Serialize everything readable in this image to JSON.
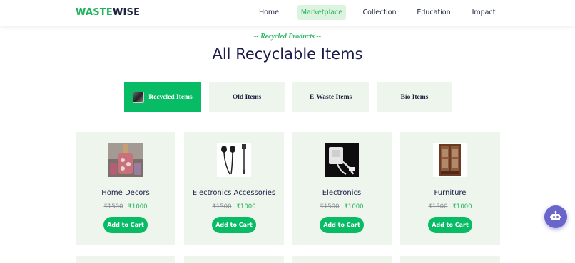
{
  "header": {
    "logo_part1": "WASTE",
    "logo_part2": "WISE",
    "nav": [
      {
        "label": "Home",
        "active": false
      },
      {
        "label": "Marketplace",
        "active": true
      },
      {
        "label": "Collection",
        "active": false
      },
      {
        "label": "Education",
        "active": false
      },
      {
        "label": "Impact",
        "active": false
      }
    ]
  },
  "section": {
    "eyebrow": "-- Recycled Products --",
    "title": "All Recyclable Items"
  },
  "tabs": [
    {
      "label": "Recycled Items",
      "active": true,
      "icon": "recycled-items-thumbnail"
    },
    {
      "label": "Old Items",
      "active": false
    },
    {
      "label": "E-Waste Items",
      "active": false
    },
    {
      "label": "Bio Items",
      "active": false
    }
  ],
  "products": [
    {
      "name": "Home Decors",
      "old_price": "₹1500",
      "new_price": "₹1000",
      "button": "Add to Cart",
      "image": "decor-bottles-image"
    },
    {
      "name": "Electronics Accessories",
      "old_price": "₹1500",
      "new_price": "₹1000",
      "button": "Add to Cart",
      "image": "earphones-image"
    },
    {
      "name": "Electronics",
      "old_price": "₹1500",
      "new_price": "₹1000",
      "button": "Add to Cart",
      "image": "charger-image"
    },
    {
      "name": "Furniture",
      "old_price": "₹1500",
      "new_price": "₹1000",
      "button": "Add to Cart",
      "image": "wardrobe-image"
    }
  ],
  "colors": {
    "brand_green": "#21b35b",
    "button_green": "#07bc64",
    "card_bg": "#eef5ec",
    "title_navy": "#1a1d4a",
    "bot_purple": "#6a66c9"
  },
  "chatbot": {
    "icon": "robot-icon"
  }
}
